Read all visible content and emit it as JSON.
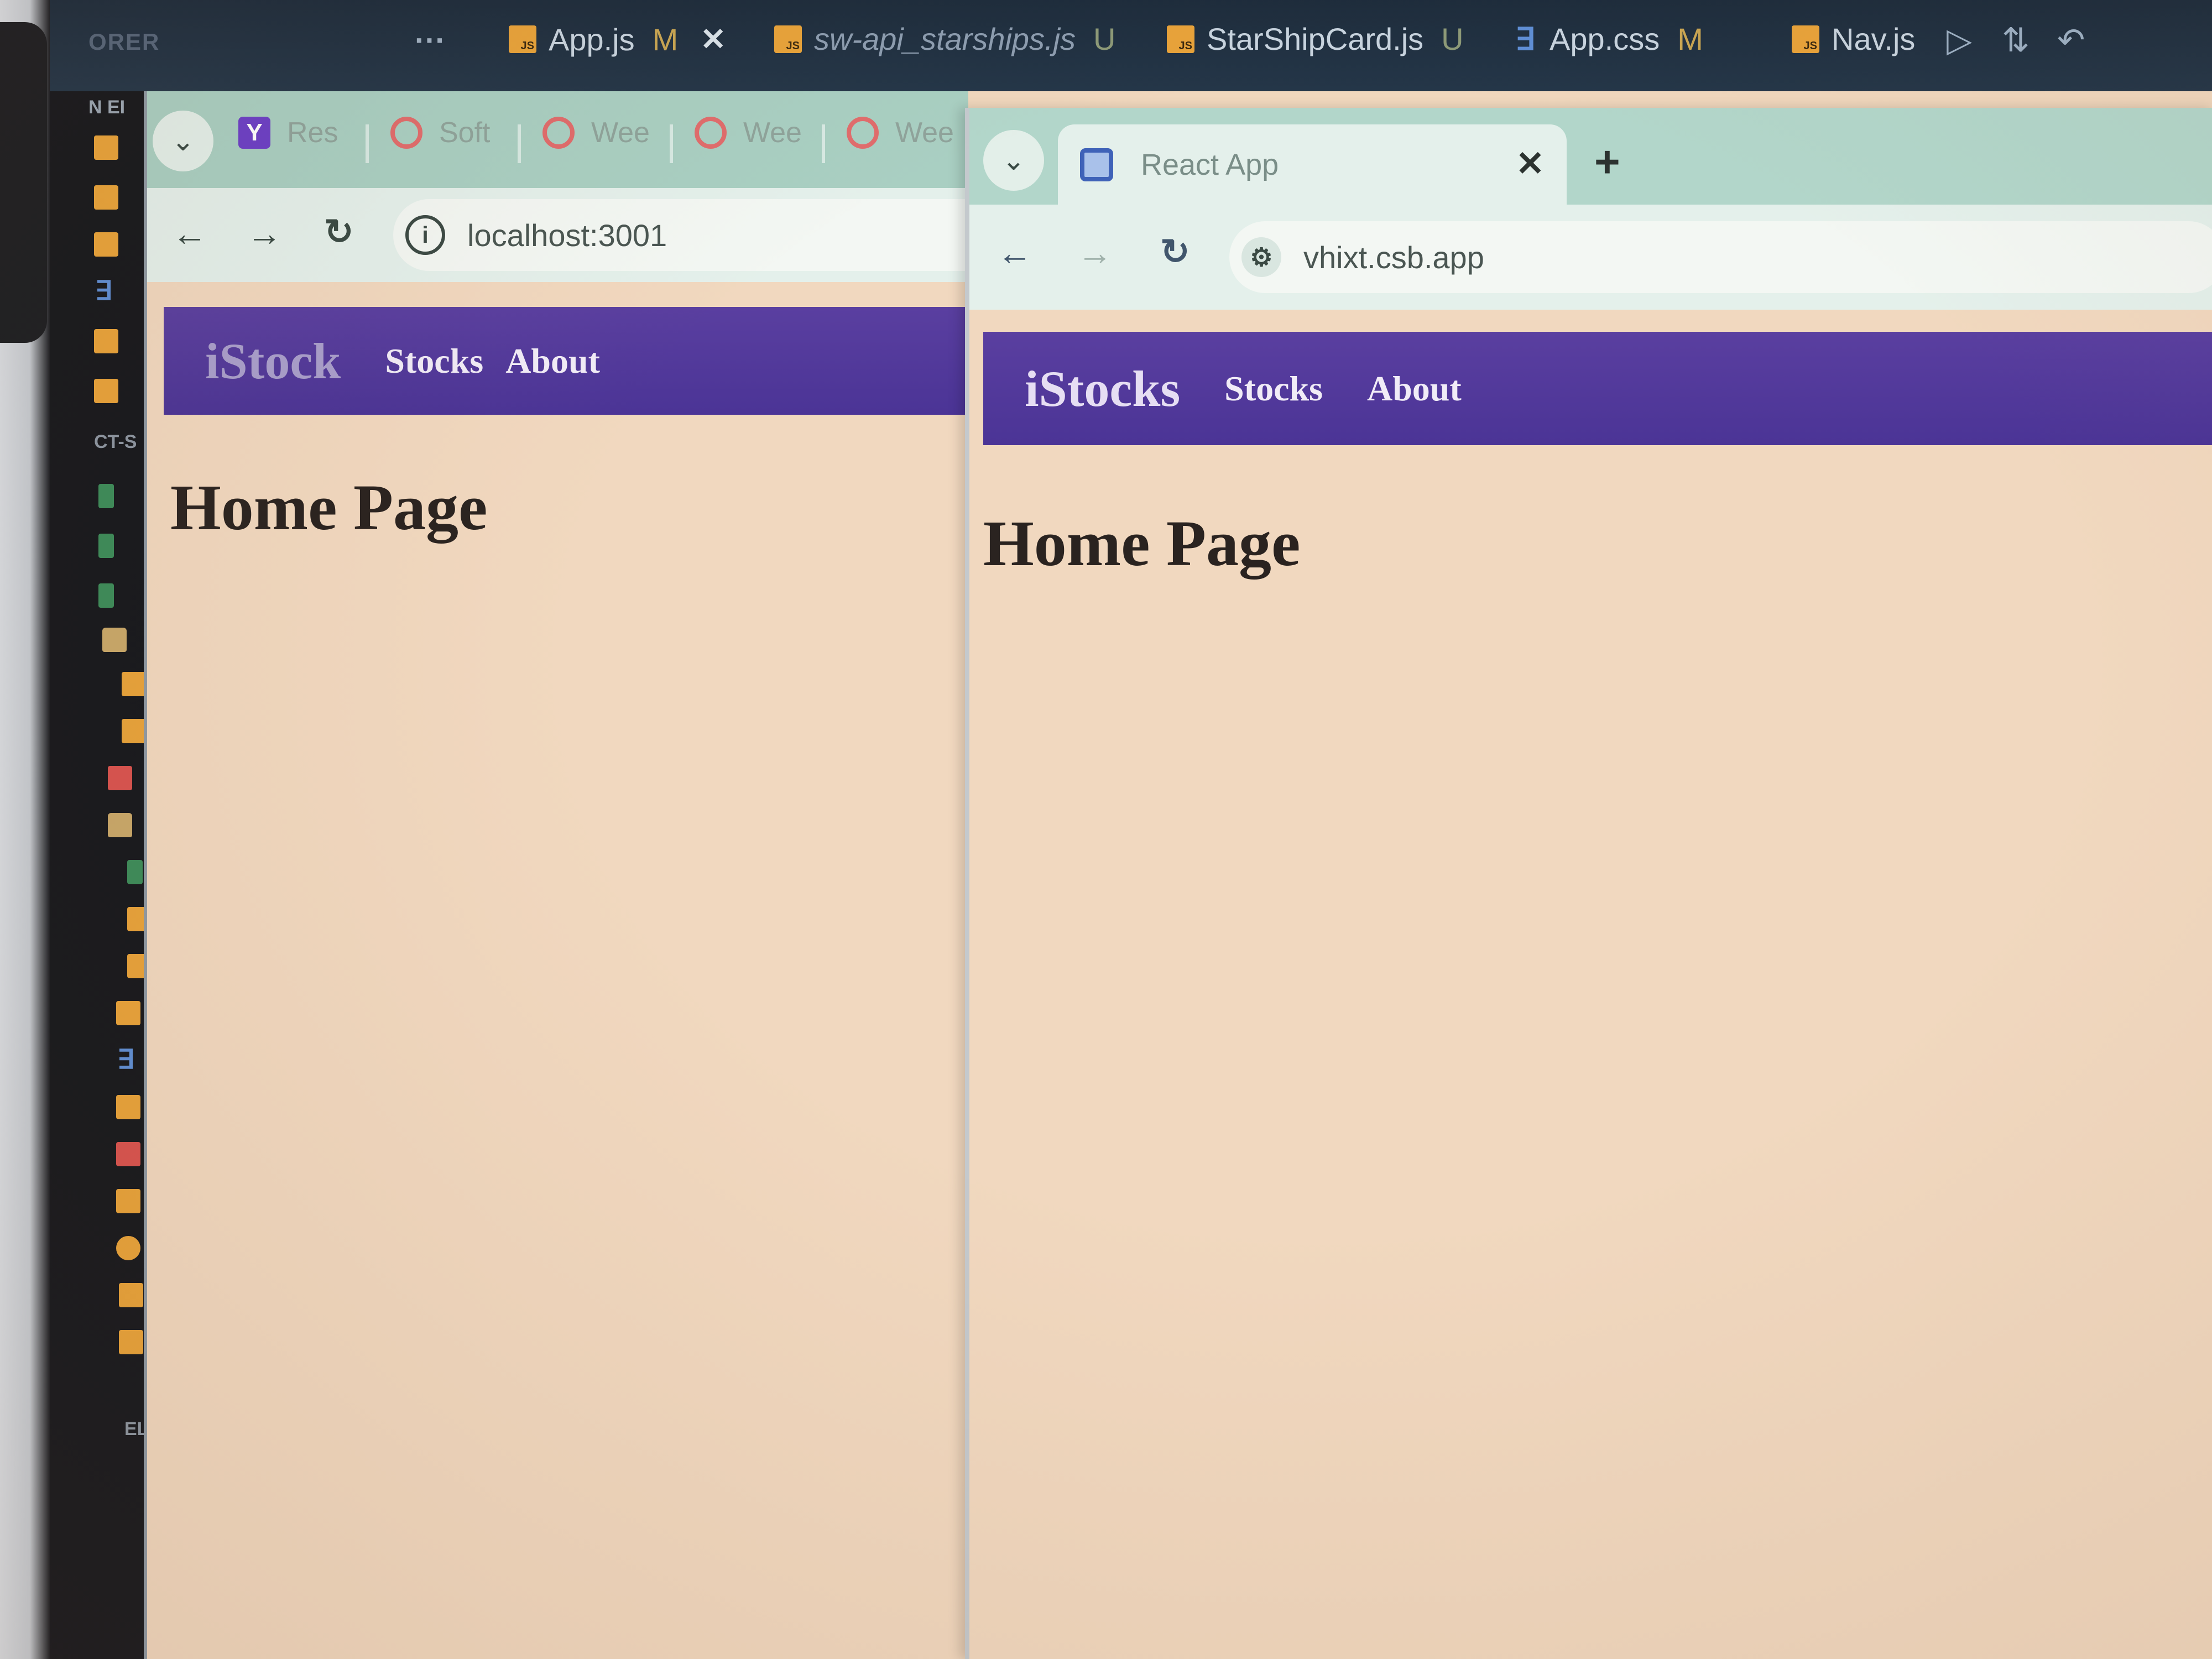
{
  "vscode": {
    "order_label": "ORER",
    "overflow_label": "···",
    "explorer_header": "N EI",
    "explorer_labels": [
      "CT-S",
      "ELIN"
    ],
    "tabs": [
      {
        "label": "App.js",
        "flag": "M",
        "icon": "js-file-icon",
        "italic": false,
        "close": "✕"
      },
      {
        "label": "sw-api_starships.js",
        "flag": "U",
        "icon": "js-file-icon",
        "italic": true
      },
      {
        "label": "StarShipCard.js",
        "flag": "U",
        "icon": "js-file-icon",
        "italic": false
      },
      {
        "label": "App.css",
        "flag": "M",
        "icon": "css-file-icon",
        "italic": false
      },
      {
        "label": "Nav.js",
        "flag": "",
        "icon": "js-file-icon",
        "italic": false
      }
    ],
    "toolbar_icons": [
      "run-icon",
      "compare-changes-icon",
      "go-back-icon"
    ]
  },
  "left_browser": {
    "tab_menu_icon": "chevron-down-icon",
    "tabs": [
      {
        "label": "Res",
        "icon": "yahoo-favicon"
      },
      {
        "label": "Soft",
        "icon": "opera-favicon"
      },
      {
        "label": "Wee",
        "icon": "opera-favicon"
      },
      {
        "label": "Wee",
        "icon": "opera-favicon"
      },
      {
        "label": "Wee",
        "icon": "opera-favicon"
      }
    ],
    "url": "localhost:3001",
    "site_info_icon": "info-icon",
    "nav": {
      "brand": "iStock",
      "links": [
        "Stocks",
        "About"
      ]
    },
    "heading": "Home Page"
  },
  "right_browser": {
    "tab_menu_icon": "chevron-down-icon",
    "active_tab": {
      "title": "React App",
      "close": "✕"
    },
    "new_tab_label": "+",
    "url": "vhixt.csb.app",
    "site_info_icon": "tune-icon",
    "nav": {
      "brand": "iStocks",
      "links": [
        "Stocks",
        "About"
      ]
    },
    "heading": "Home Page"
  },
  "colors": {
    "navbar": "#4b3496",
    "page_background": "#f1d8bf",
    "tabstrip": "#a9cfc2",
    "vscode_tabbar": "#1d2c3c"
  }
}
